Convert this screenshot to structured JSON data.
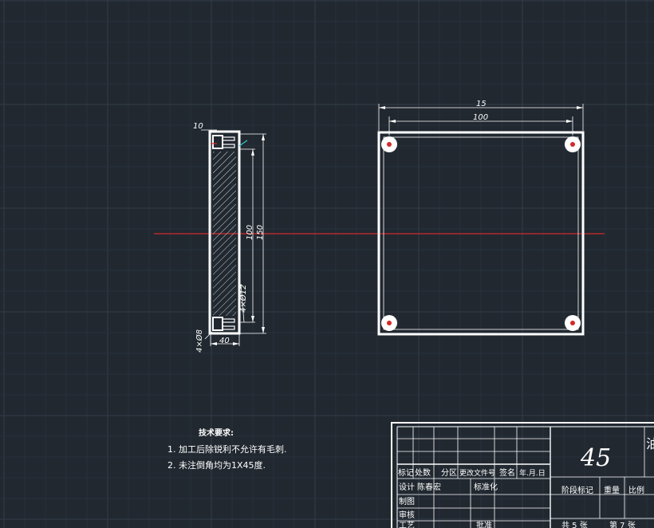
{
  "drawing": {
    "side_view": {
      "dims": {
        "top_width": "10",
        "inner_height": "100",
        "outer_height": "150",
        "hole_callout": "4×Ø12",
        "small_hole": "4×Ø8",
        "bottom_width": "40"
      }
    },
    "plan_view": {
      "dims": {
        "outer_width": "15",
        "inner_width": "100"
      }
    },
    "notes": {
      "heading": "技术要求:",
      "items": [
        "1.  加工后除锐利不允许有毛刺.",
        "2.  未注倒角均为1X45度."
      ]
    },
    "title_block": {
      "material": "45",
      "headers": [
        "标记",
        "处数",
        "分区",
        "更改文件号",
        "签名",
        "年.月.日"
      ],
      "design_label": "设计",
      "designer": "陈春宏",
      "standardization": "标准化",
      "draw_label": "制图",
      "check_label": "审核",
      "craft_label": "工艺",
      "approve_label": "批准",
      "stage_label": "阶段标记",
      "weight_label": "重量",
      "scale_label": "比例",
      "sheets_total": "共 5 张",
      "sheet_no": "第 7 张",
      "edge_char": "油"
    }
  }
}
